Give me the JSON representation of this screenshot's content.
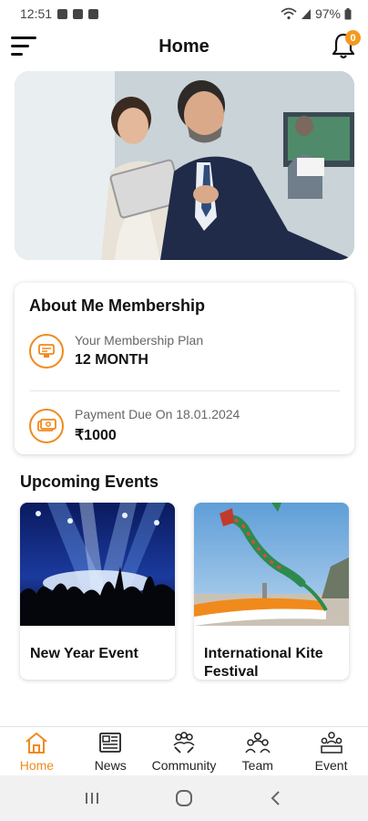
{
  "status_bar": {
    "time": "12:51",
    "battery": "97%"
  },
  "header": {
    "title": "Home",
    "notification_count": "0"
  },
  "membership": {
    "title": "About Me Membership",
    "plan_label": "Your Membership Plan",
    "plan_value": "12 MONTH",
    "due_label": "Payment Due On 18.01.2024",
    "due_value": "₹1000"
  },
  "events": {
    "title": "Upcoming Events",
    "items": [
      {
        "name": "New Year Event"
      },
      {
        "name": "International Kite Festival"
      }
    ]
  },
  "bottom_nav": {
    "items": [
      {
        "label": "Home",
        "icon": "home-icon",
        "active": true
      },
      {
        "label": "News",
        "icon": "news-icon",
        "active": false
      },
      {
        "label": "Community",
        "icon": "community-icon",
        "active": false
      },
      {
        "label": "Team",
        "icon": "team-icon",
        "active": false
      },
      {
        "label": "Event",
        "icon": "event-icon",
        "active": false
      }
    ]
  },
  "colors": {
    "accent": "#f08a1c",
    "badge": "#f39a1f"
  }
}
